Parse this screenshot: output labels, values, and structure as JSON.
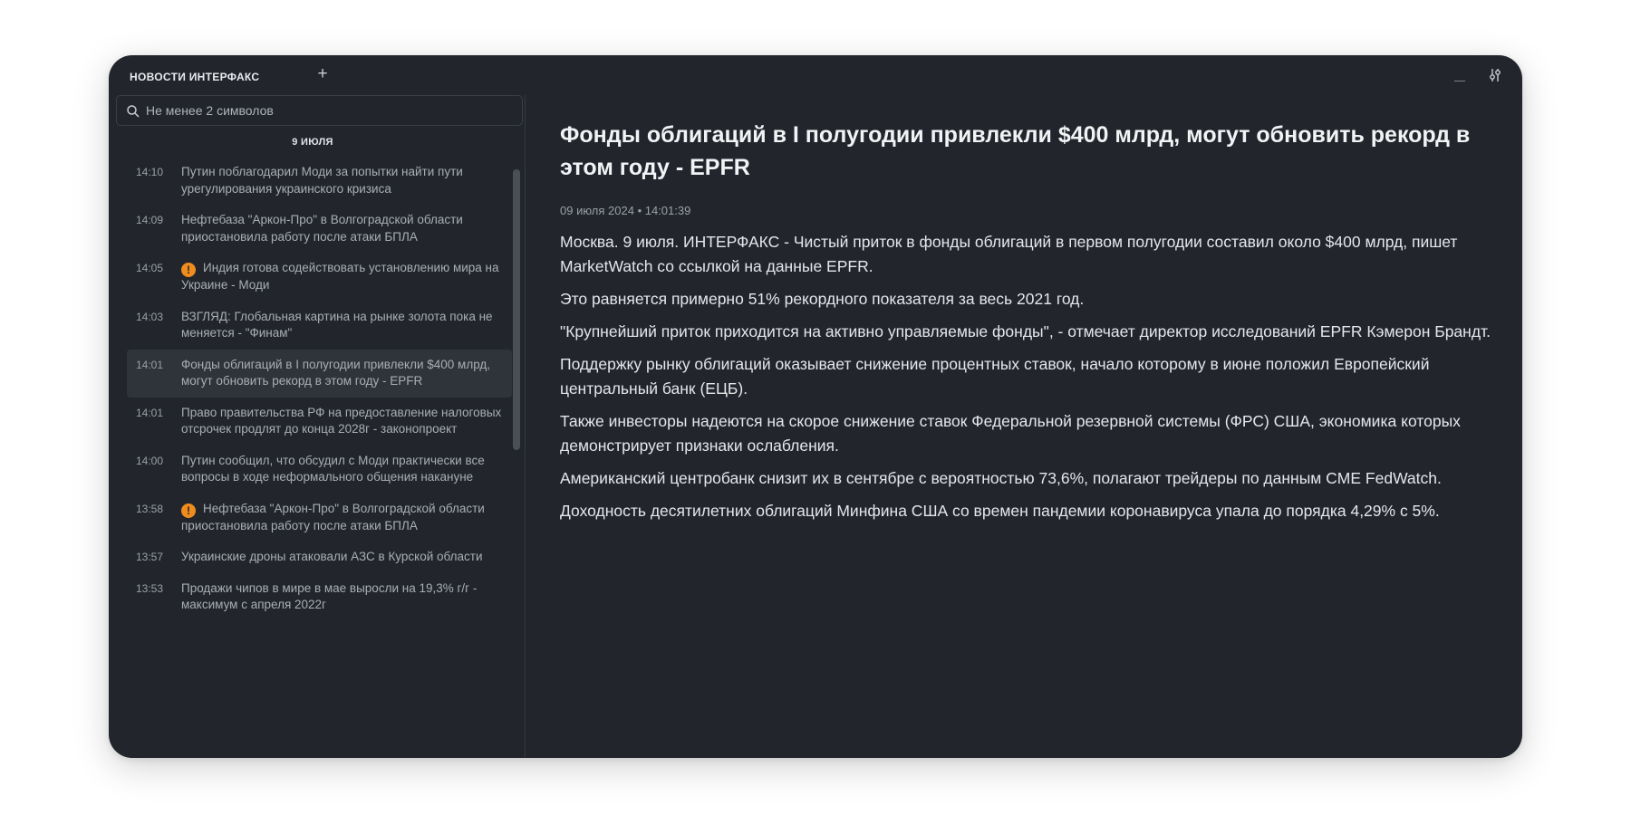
{
  "window": {
    "title": "НОВОСТИ ИНТЕРФАКС",
    "add_label": "+"
  },
  "search": {
    "placeholder": "Не менее 2 символов",
    "value": ""
  },
  "feed": {
    "date": "9 ИЮЛЯ",
    "items": [
      {
        "time": "14:10",
        "text": "Путин поблагодарил Моди за попытки найти пути урегулирования украинского кризиса",
        "important": false,
        "active": false
      },
      {
        "time": "14:09",
        "text": "Нефтебаза \"Аркон-Про\" в Волгоградской области приостановила работу после атаки БПЛА",
        "important": false,
        "active": false
      },
      {
        "time": "14:05",
        "text": "Индия готова содействовать установлению мира на Украине - Моди",
        "important": true,
        "active": false
      },
      {
        "time": "14:03",
        "text": "ВЗГЛЯД: Глобальная картина на рынке золота пока не меняется - \"Финам\"",
        "important": false,
        "active": false
      },
      {
        "time": "14:01",
        "text": "Фонды облигаций в I полугодии привлекли $400 млрд, могут обновить рекорд в этом году - EPFR",
        "important": false,
        "active": true
      },
      {
        "time": "14:01",
        "text": "Право правительства РФ на предоставление налоговых отсрочек продлят до конца 2028г - законопроект",
        "important": false,
        "active": false
      },
      {
        "time": "14:00",
        "text": "Путин сообщил, что обсудил с Моди практически все вопросы в ходе неформального общения накануне",
        "important": false,
        "active": false
      },
      {
        "time": "13:58",
        "text": "Нефтебаза \"Аркон-Про\" в Волгоградской области приостановила работу после атаки БПЛА",
        "important": true,
        "active": false
      },
      {
        "time": "13:57",
        "text": "Украинские дроны атаковали АЗС в Курской области",
        "important": false,
        "active": false
      },
      {
        "time": "13:53",
        "text": "Продажи чипов в мире в мае выросли на 19,3% г/г - максимум с апреля 2022г",
        "important": false,
        "active": false
      }
    ]
  },
  "article": {
    "title": "Фонды облигаций в I полугодии привлекли $400 млрд, могут обновить рекорд в этом году - EPFR",
    "date": "09 июля 2024 • 14:01:39",
    "paragraphs": [
      "Москва. 9 июля. ИНТЕРФАКС - Чистый приток в фонды облигаций в первом полугодии составил около $400 млрд, пишет MarketWatch со ссылкой на данные EPFR.",
      "Это равняется примерно 51% рекордного показателя за весь 2021 год.",
      "\"Крупнейший приток приходится на активно управляемые фонды\", - отмечает директор исследований EPFR Кэмерон Брандт.",
      "Поддержку рынку облигаций оказывает снижение процентных ставок, начало которому в июне положил Европейский центральный банк (ЕЦБ).",
      "Также инвесторы надеются на скорое снижение ставок Федеральной резервной системы (ФРС) США, экономика которых демонстрирует признаки ослабления.",
      "Американский центробанк снизит их в сентябре с вероятностью 73,6%, полагают трейдеры по данным CME FedWatch.",
      "Доходность десятилетних облигаций Минфина США со времен пандемии коронавируса упала до порядка 4,29% с 5%."
    ]
  },
  "colors": {
    "background": "#22262c",
    "active_item": "#2f343b",
    "important_badge": "#f08c1e"
  },
  "icons": {
    "search": "search-icon",
    "important": "exclamation-icon",
    "minimize": "minimize-icon",
    "settings": "sliders-icon"
  }
}
